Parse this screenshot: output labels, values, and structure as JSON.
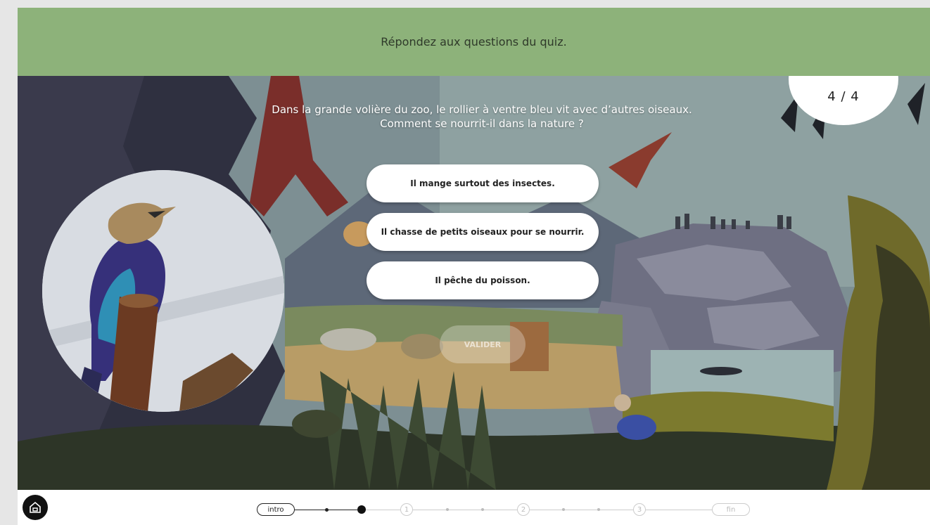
{
  "header": {
    "instruction": "Répondez aux questions du quiz."
  },
  "quiz": {
    "counter": "4 / 4",
    "question_line1": "Dans la grande volière du zoo, le rollier à ventre bleu vit avec d’autres oiseaux.",
    "question_line2": "Comment se nourrit-il dans la nature ?",
    "answers": [
      "Il mange surtout des insectes.",
      "Il chasse de petits oiseaux pour se nourrir.",
      "Il pêche du poisson."
    ],
    "validate_label": "VALIDER"
  },
  "footer": {
    "home_icon": "home-icon",
    "progress": {
      "intro": "intro",
      "steps": [
        "1",
        "2",
        "3"
      ],
      "fin": "fin"
    }
  },
  "colors": {
    "header_bg": "#8db27a",
    "scene_dark": "#3a3b4a",
    "rock": "#6d6e80",
    "water": "#9ab0b0",
    "bird_blue": "#3a4fa3"
  }
}
